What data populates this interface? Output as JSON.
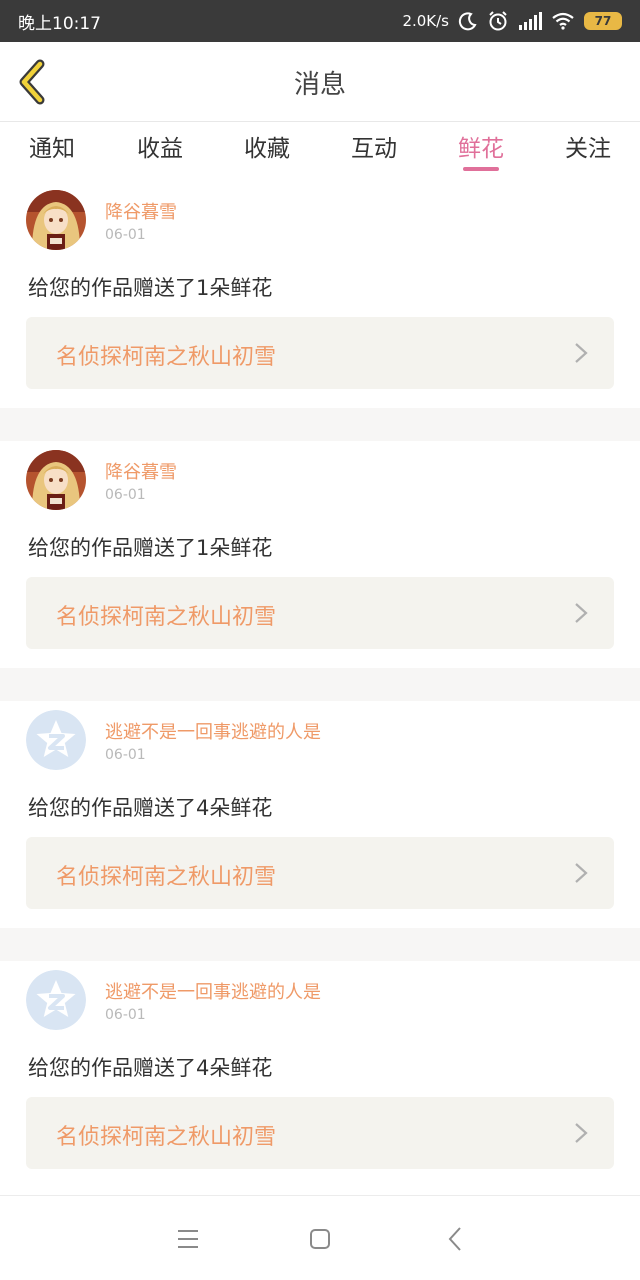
{
  "status_bar": {
    "time": "晚上10:17",
    "network_speed": "2.0K/s",
    "battery": "77",
    "icons": [
      "moon-icon",
      "alarm-icon",
      "signal-icon",
      "wifi-icon",
      "battery-icon"
    ]
  },
  "header": {
    "title": "消息",
    "back_icon": "chevron-left-icon"
  },
  "tabs": [
    {
      "label": "通知",
      "active": false
    },
    {
      "label": "收益",
      "active": false
    },
    {
      "label": "收藏",
      "active": false
    },
    {
      "label": "互动",
      "active": false
    },
    {
      "label": "鲜花",
      "active": true
    },
    {
      "label": "关注",
      "active": false
    }
  ],
  "messages": [
    {
      "username": "降谷暮雪",
      "date": "06-01",
      "text": "给您的作品赠送了1朵鲜花",
      "work_title": "名侦探柯南之秋山初雪",
      "avatar": "anime-avatar"
    },
    {
      "username": "降谷暮雪",
      "date": "06-01",
      "text": "给您的作品赠送了1朵鲜花",
      "work_title": "名侦探柯南之秋山初雪",
      "avatar": "anime-avatar"
    },
    {
      "username": "逃避不是一回事逃避的人是",
      "date": "06-01",
      "text": "给您的作品赠送了4朵鲜花",
      "work_title": "名侦探柯南之秋山初雪",
      "avatar": "default-avatar"
    },
    {
      "username": "逃避不是一回事逃避的人是",
      "date": "06-01",
      "text": "给您的作品赠送了4朵鲜花",
      "work_title": "名侦探柯南之秋山初雪",
      "avatar": "default-avatar"
    }
  ],
  "bottom_nav": {
    "icons": [
      "menu-icon",
      "home-square-icon",
      "back-triangle-icon"
    ]
  },
  "colors": {
    "accent_pink": "#e0709a",
    "username_orange": "#ef9a68",
    "status_bar_bg": "#3a3a3a",
    "card_link_bg": "#f4f3ee"
  }
}
